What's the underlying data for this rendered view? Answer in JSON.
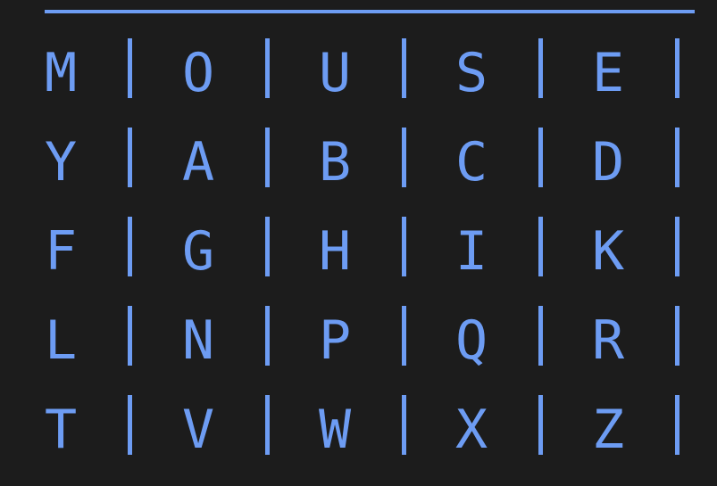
{
  "accent_color": "#6d9cf3",
  "background_color": "#1c1c1c",
  "rows": [
    {
      "cells": [
        "M",
        "O",
        "U",
        "S",
        "E"
      ]
    },
    {
      "cells": [
        "Y",
        "A",
        "B",
        "C",
        "D"
      ]
    },
    {
      "cells": [
        "F",
        "G",
        "H",
        "I",
        "K"
      ]
    },
    {
      "cells": [
        "L",
        "N",
        "P",
        "Q",
        "R"
      ]
    },
    {
      "cells": [
        "T",
        "V",
        "W",
        "X",
        "Z"
      ]
    }
  ]
}
